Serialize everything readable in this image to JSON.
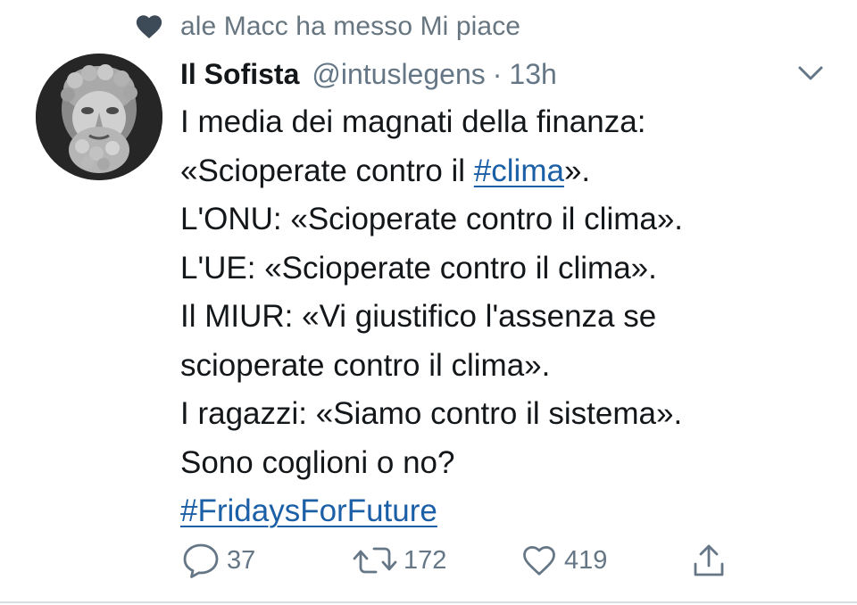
{
  "social_context": {
    "text": "ale Macc ha messo Mi piace",
    "icon": "heart-filled-icon"
  },
  "tweet": {
    "author_name": "Il Sofista",
    "handle": "@intuslegens",
    "separator": "·",
    "time": "13h",
    "lines": [
      {
        "before": "I media dei magnati della finanza:"
      },
      {
        "before": "«Scioperate contro il ",
        "hashtag": "#clima",
        "after": "»."
      },
      {
        "before": "L'ONU: «Scioperate contro il clima»."
      },
      {
        "before": "L'UE: «Scioperate contro il clima»."
      },
      {
        "before": "Il MIUR: «Vi giustifico l'assenza se"
      },
      {
        "before": "scioperate contro il clima»."
      },
      {
        "before": "I ragazzi: «Siamo contro il sistema»."
      },
      {
        "before": "Sono coglioni o no?"
      },
      {
        "hashtag": "#FridaysForFuture"
      }
    ],
    "avatar": "bust-statue-avatar"
  },
  "actions": {
    "reply_count": "37",
    "retweet_count": "172",
    "like_count": "419",
    "icons": [
      "reply-icon",
      "retweet-icon",
      "like-icon",
      "share-icon"
    ]
  },
  "colors": {
    "text": "#14171a",
    "muted": "#657786",
    "link": "#1b5fa6",
    "divider": "#d6dde3"
  }
}
